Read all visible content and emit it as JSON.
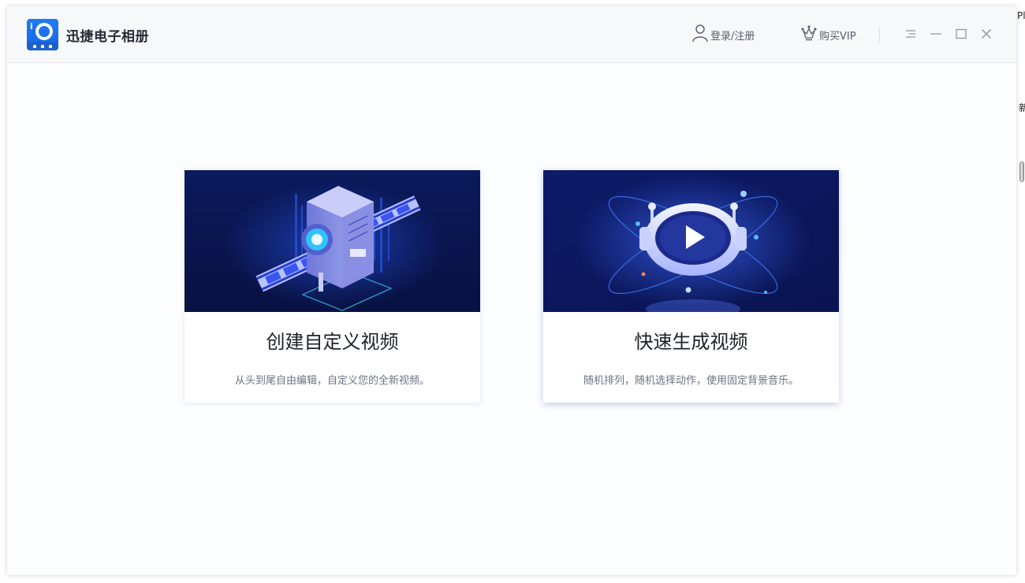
{
  "app": {
    "title": "迅捷电子相册"
  },
  "header": {
    "login_label": "登录/注册",
    "vip_label": "购买VIP"
  },
  "cards": [
    {
      "title": "创建自定义视频",
      "description": "从头到尾自由编辑，自定义您的全新视频。"
    },
    {
      "title": "快速生成视频",
      "description": "随机排列，随机选择动作，使用固定背景音乐。"
    }
  ],
  "background": {
    "text_top": "Pl",
    "text_mid": "新"
  },
  "colors": {
    "brand_blue": "#1f7bf5",
    "banner_dark": "#0b1650",
    "title_text": "#1d2129"
  },
  "icons": [
    "user-icon",
    "crown-icon",
    "menu-icon",
    "minimize-icon",
    "maximize-icon",
    "close-icon"
  ]
}
